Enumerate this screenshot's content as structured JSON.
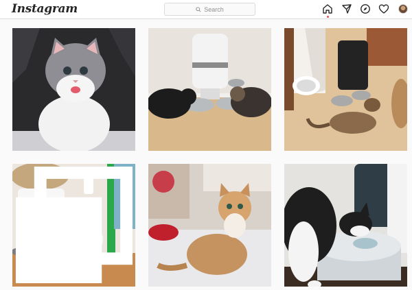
{
  "app": {
    "logo_text": "Instagram"
  },
  "search": {
    "placeholder": "Search",
    "icon": "search-icon"
  },
  "nav": {
    "items": [
      {
        "name": "home",
        "icon": "home-icon",
        "active": true
      },
      {
        "name": "direct",
        "icon": "paper-plane-icon"
      },
      {
        "name": "explore",
        "icon": "compass-icon"
      },
      {
        "name": "activity",
        "icon": "heart-icon"
      },
      {
        "name": "profile",
        "icon": "avatar"
      }
    ]
  },
  "posts": [
    {
      "subject": "grey and white kitten with tongue out on dark fur blanket"
    },
    {
      "subject": "two cats eating from bowls under a white automatic feeder"
    },
    {
      "subject": "cat eating near a black automatic feeder and a white water fountain"
    },
    {
      "subject": "white and black rabbit beside a white feeder and cat tree"
    },
    {
      "subject": "orange and white long-haired cat sitting on a bed"
    },
    {
      "subject": "black and white cat drinking from a pet water fountain"
    }
  ],
  "colors": {
    "background": "#fafafa",
    "header": "#ffffff",
    "border": "#dbdbdb",
    "text": "#262626",
    "muted": "#8e8e8e",
    "notification": "#ed4956"
  }
}
